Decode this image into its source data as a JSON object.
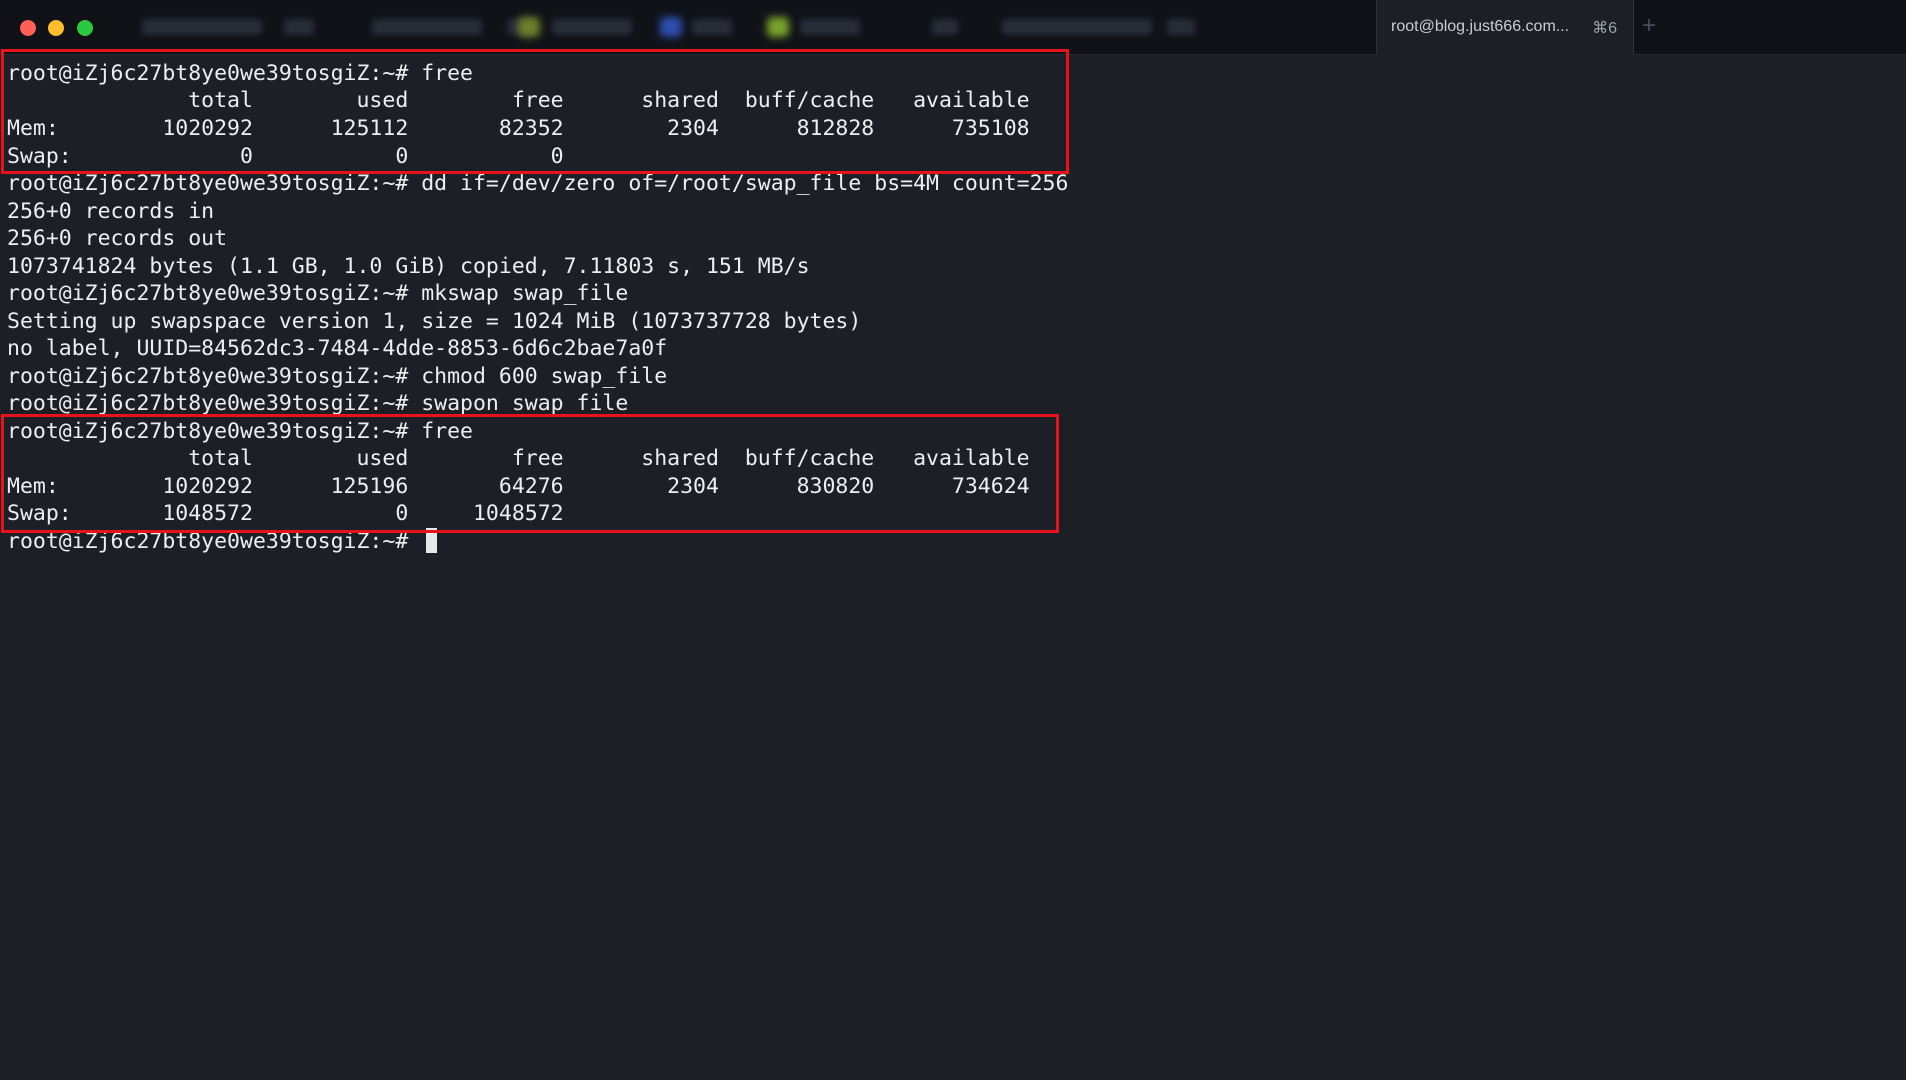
{
  "window": {
    "active_tab": {
      "title": "root@blog.just666.com...",
      "shortcut": "⌘6"
    },
    "new_tab_label": "+"
  },
  "terminal": {
    "lines": [
      "root@iZj6c27bt8ye0we39tosgiZ:~# free",
      "              total        used        free      shared  buff/cache   available",
      "Mem:        1020292      125112       82352        2304      812828      735108",
      "Swap:             0           0           0",
      "root@iZj6c27bt8ye0we39tosgiZ:~# dd if=/dev/zero of=/root/swap_file bs=4M count=256",
      "256+0 records in",
      "256+0 records out",
      "1073741824 bytes (1.1 GB, 1.0 GiB) copied, 7.11803 s, 151 MB/s",
      "root@iZj6c27bt8ye0we39tosgiZ:~# mkswap swap_file",
      "Setting up swapspace version 1, size = 1024 MiB (1073737728 bytes)",
      "no label, UUID=84562dc3-7484-4dde-8853-6d6c2bae7a0f",
      "root@iZj6c27bt8ye0we39tosgiZ:~# chmod 600 swap_file",
      "root@iZj6c27bt8ye0we39tosgiZ:~# swapon swap_file",
      "root@iZj6c27bt8ye0we39tosgiZ:~# free",
      "              total        used        free      shared  buff/cache   available",
      "Mem:        1020292      125196       64276        2304      830820      734624",
      "Swap:       1048572           0     1048572",
      "root@iZj6c27bt8ye0we39tosgiZ:~# "
    ]
  },
  "colors": {
    "background": "#1d1f26",
    "text": "#eceef2",
    "highlight_border": "#e8121d",
    "traffic_close": "#ff5f57",
    "traffic_minimize": "#febc2e",
    "traffic_zoom": "#28c840"
  }
}
